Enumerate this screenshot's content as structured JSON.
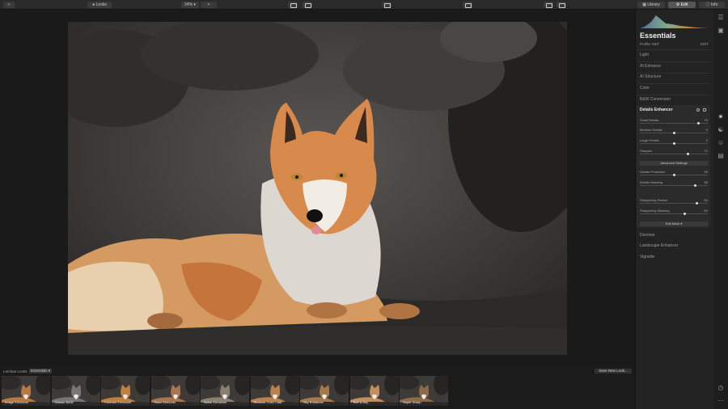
{
  "topbar": {
    "looks_label": "Looks",
    "zoom": "24%",
    "library_tab": "Library",
    "edit_tab": "Edit",
    "info_tab": "Info"
  },
  "panel": {
    "title": "Essentials",
    "profile_label": "Profile: NEF",
    "profile_action": "EDIT",
    "sections_top": [
      "Light",
      "AI Enhance",
      "AI Structure",
      "Color",
      "B&W Conversion"
    ],
    "details_enhancer": {
      "title": "Details Enhancer",
      "sliders": [
        {
          "label": "Small Details",
          "value": "75",
          "fraction": 0.86
        },
        {
          "label": "Medium Details",
          "value": "0",
          "fraction": 0.5
        },
        {
          "label": "Large Details",
          "value": "0",
          "fraction": 0.5
        },
        {
          "label": "Sharpen",
          "value": "71",
          "fraction": 0.71
        }
      ],
      "advanced_label": "Advanced Settings",
      "adv_sliders": [
        {
          "label": "Details Protection",
          "value": "50",
          "fraction": 0.5
        },
        {
          "label": "Details Masking",
          "value": "85",
          "fraction": 0.81
        }
      ],
      "sharp_sliders": [
        {
          "label": "Sharpening Radius",
          "value": "84",
          "fraction": 0.84
        },
        {
          "label": "Sharpening Masking",
          "value": "60",
          "fraction": 0.66
        }
      ],
      "edit_mask": "Edit Mask ▾"
    },
    "sections_bottom": [
      "Denoise",
      "Landscape Enhancer",
      "Vignette"
    ]
  },
  "bottom": {
    "tab1": "Luminar Looks",
    "tab2": "Essentials ▾",
    "save_new_look": "Save New Look...",
    "thumbnails": [
      "Image Enhancer",
      "Classic B&W",
      "Contrast Enhancer",
      "Haze Removal",
      "Noise Enhancer",
      "Remove Color Cast",
      "Sky Enhancer",
      "Soft & Airy",
      "Super Sharp"
    ]
  },
  "icons": {
    "essentials": "sun-icon",
    "creative": "palette-icon",
    "portrait": "face-icon",
    "pro": "pro-icon",
    "history": "clock-icon",
    "more": "ellipsis-icon"
  }
}
